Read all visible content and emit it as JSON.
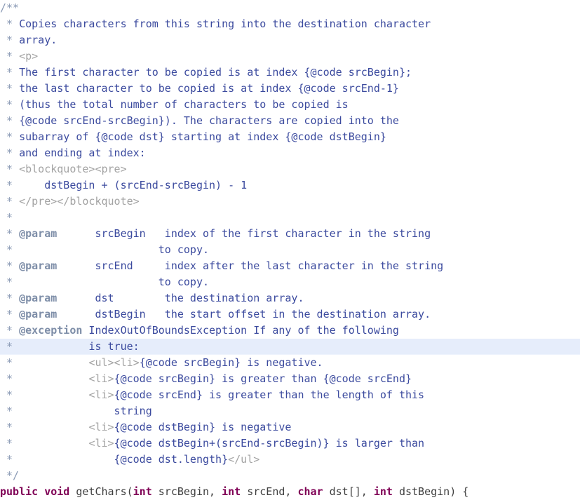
{
  "editor": {
    "language": "Java",
    "font_size_px": 15,
    "line_height_px": 23,
    "colors": {
      "background": "#ffffff",
      "comment": "#3b4a9e",
      "comment_punctuation": "#8a9ab5",
      "html_tag": "#a3a3a3",
      "javadoc_tag": "#7e8ea8",
      "keyword": "#7f0055",
      "identifier": "#3f3f3f",
      "current_line_highlight": "#e6edfb"
    },
    "current_line_index": 21,
    "lines": [
      {
        "id": "l1",
        "text": "/**",
        "tokens": [
          {
            "t": "/**",
            "c": "tok-comment-punct"
          }
        ]
      },
      {
        "id": "l2",
        "text": " * Copies characters from this string into the destination character",
        "tokens": [
          {
            "t": " * ",
            "c": "tok-comment-punct"
          },
          {
            "t": "Copies characters from this string into the destination character",
            "c": "tok-comment"
          }
        ]
      },
      {
        "id": "l3",
        "text": " * array.",
        "tokens": [
          {
            "t": " * ",
            "c": "tok-comment-punct"
          },
          {
            "t": "array.",
            "c": "tok-comment"
          }
        ]
      },
      {
        "id": "l4",
        "text": " * <p>",
        "tokens": [
          {
            "t": " * ",
            "c": "tok-comment-punct"
          },
          {
            "t": "<p>",
            "c": "tok-html"
          }
        ]
      },
      {
        "id": "l5",
        "text": " * The first character to be copied is at index {@code srcBegin};",
        "tokens": [
          {
            "t": " * ",
            "c": "tok-comment-punct"
          },
          {
            "t": "The first character to be copied is at index {@code srcBegin};",
            "c": "tok-comment"
          }
        ]
      },
      {
        "id": "l6",
        "text": " * the last character to be copied is at index {@code srcEnd-1}",
        "tokens": [
          {
            "t": " * ",
            "c": "tok-comment-punct"
          },
          {
            "t": "the last character to be copied is at index {@code srcEnd-1}",
            "c": "tok-comment"
          }
        ]
      },
      {
        "id": "l7",
        "text": " * (thus the total number of characters to be copied is",
        "tokens": [
          {
            "t": " * ",
            "c": "tok-comment-punct"
          },
          {
            "t": "(thus the total number of characters to be copied is",
            "c": "tok-comment"
          }
        ]
      },
      {
        "id": "l8",
        "text": " * {@code srcEnd-srcBegin}). The characters are copied into the",
        "tokens": [
          {
            "t": " * ",
            "c": "tok-comment-punct"
          },
          {
            "t": "{@code srcEnd-srcBegin}). The characters are copied into the",
            "c": "tok-comment"
          }
        ]
      },
      {
        "id": "l9",
        "text": " * subarray of {@code dst} starting at index {@code dstBegin}",
        "tokens": [
          {
            "t": " * ",
            "c": "tok-comment-punct"
          },
          {
            "t": "subarray of {@code dst} starting at index {@code dstBegin}",
            "c": "tok-comment"
          }
        ]
      },
      {
        "id": "l10",
        "text": " * and ending at index:",
        "tokens": [
          {
            "t": " * ",
            "c": "tok-comment-punct"
          },
          {
            "t": "and ending at index:",
            "c": "tok-comment"
          }
        ]
      },
      {
        "id": "l11",
        "text": " * <blockquote><pre>",
        "tokens": [
          {
            "t": " * ",
            "c": "tok-comment-punct"
          },
          {
            "t": "<blockquote><pre>",
            "c": "tok-html"
          }
        ]
      },
      {
        "id": "l12",
        "text": " *     dstBegin + (srcEnd-srcBegin) - 1",
        "tokens": [
          {
            "t": " * ",
            "c": "tok-comment-punct"
          },
          {
            "t": "    dstBegin + (srcEnd-srcBegin) - 1",
            "c": "tok-comment"
          }
        ]
      },
      {
        "id": "l13",
        "text": " * </pre></blockquote>",
        "tokens": [
          {
            "t": " * ",
            "c": "tok-comment-punct"
          },
          {
            "t": "</pre></blockquote>",
            "c": "tok-html"
          }
        ]
      },
      {
        "id": "l14",
        "text": " *",
        "tokens": [
          {
            "t": " *",
            "c": "tok-comment-punct"
          }
        ]
      },
      {
        "id": "l15",
        "text": " * @param      srcBegin   index of the first character in the string",
        "tokens": [
          {
            "t": " * ",
            "c": "tok-comment-punct"
          },
          {
            "t": "@param",
            "c": "tok-tag"
          },
          {
            "t": "      srcBegin   index of the first character in the string",
            "c": "tok-comment"
          }
        ]
      },
      {
        "id": "l16",
        "text": " *                        to copy.",
        "tokens": [
          {
            "t": " * ",
            "c": "tok-comment-punct"
          },
          {
            "t": "                      to copy.",
            "c": "tok-comment"
          }
        ]
      },
      {
        "id": "l17",
        "text": " * @param      srcEnd     index after the last character in the string",
        "tokens": [
          {
            "t": " * ",
            "c": "tok-comment-punct"
          },
          {
            "t": "@param",
            "c": "tok-tag"
          },
          {
            "t": "      srcEnd     index after the last character in the string",
            "c": "tok-comment"
          }
        ]
      },
      {
        "id": "l18",
        "text": " *                        to copy.",
        "tokens": [
          {
            "t": " * ",
            "c": "tok-comment-punct"
          },
          {
            "t": "                      to copy.",
            "c": "tok-comment"
          }
        ]
      },
      {
        "id": "l19",
        "text": " * @param      dst        the destination array.",
        "tokens": [
          {
            "t": " * ",
            "c": "tok-comment-punct"
          },
          {
            "t": "@param",
            "c": "tok-tag"
          },
          {
            "t": "      dst        the destination array.",
            "c": "tok-comment"
          }
        ]
      },
      {
        "id": "l20",
        "text": " * @param      dstBegin   the start offset in the destination array.",
        "tokens": [
          {
            "t": " * ",
            "c": "tok-comment-punct"
          },
          {
            "t": "@param",
            "c": "tok-tag"
          },
          {
            "t": "      dstBegin   the start offset in the destination array.",
            "c": "tok-comment"
          }
        ]
      },
      {
        "id": "l21",
        "text": " * @exception IndexOutOfBoundsException If any of the following",
        "tokens": [
          {
            "t": " * ",
            "c": "tok-comment-punct"
          },
          {
            "t": "@exception",
            "c": "tok-tag"
          },
          {
            "t": " IndexOutOfBoundsException If any of the following",
            "c": "tok-comment"
          }
        ]
      },
      {
        "id": "l22",
        "text": " *            is true:",
        "tokens": [
          {
            "t": " * ",
            "c": "tok-comment-punct"
          },
          {
            "t": "           is true:",
            "c": "tok-comment"
          }
        ]
      },
      {
        "id": "l23",
        "text": " *            <ul><li>{@code srcBegin} is negative.",
        "tokens": [
          {
            "t": " * ",
            "c": "tok-comment-punct"
          },
          {
            "t": "           ",
            "c": "tok-comment"
          },
          {
            "t": "<ul><li>",
            "c": "tok-html"
          },
          {
            "t": "{@code srcBegin} is negative.",
            "c": "tok-comment"
          }
        ]
      },
      {
        "id": "l24",
        "text": " *            <li>{@code srcBegin} is greater than {@code srcEnd}",
        "tokens": [
          {
            "t": " * ",
            "c": "tok-comment-punct"
          },
          {
            "t": "           ",
            "c": "tok-comment"
          },
          {
            "t": "<li>",
            "c": "tok-html"
          },
          {
            "t": "{@code srcBegin} is greater than {@code srcEnd}",
            "c": "tok-comment"
          }
        ]
      },
      {
        "id": "l25",
        "text": " *            <li>{@code srcEnd} is greater than the length of this",
        "tokens": [
          {
            "t": " * ",
            "c": "tok-comment-punct"
          },
          {
            "t": "           ",
            "c": "tok-comment"
          },
          {
            "t": "<li>",
            "c": "tok-html"
          },
          {
            "t": "{@code srcEnd} is greater than the length of this",
            "c": "tok-comment"
          }
        ]
      },
      {
        "id": "l26",
        "text": " *                string",
        "tokens": [
          {
            "t": " * ",
            "c": "tok-comment-punct"
          },
          {
            "t": "               string",
            "c": "tok-comment"
          }
        ]
      },
      {
        "id": "l27",
        "text": " *            <li>{@code dstBegin} is negative",
        "tokens": [
          {
            "t": " * ",
            "c": "tok-comment-punct"
          },
          {
            "t": "           ",
            "c": "tok-comment"
          },
          {
            "t": "<li>",
            "c": "tok-html"
          },
          {
            "t": "{@code dstBegin} is negative",
            "c": "tok-comment"
          }
        ]
      },
      {
        "id": "l28",
        "text": " *            <li>{@code dstBegin+(srcEnd-srcBegin)} is larger than",
        "tokens": [
          {
            "t": " * ",
            "c": "tok-comment-punct"
          },
          {
            "t": "           ",
            "c": "tok-comment"
          },
          {
            "t": "<li>",
            "c": "tok-html"
          },
          {
            "t": "{@code dstBegin+(srcEnd-srcBegin)} is larger than",
            "c": "tok-comment"
          }
        ]
      },
      {
        "id": "l29",
        "text": " *                {@code dst.length}</ul>",
        "tokens": [
          {
            "t": " * ",
            "c": "tok-comment-punct"
          },
          {
            "t": "               {@code dst.length}",
            "c": "tok-comment"
          },
          {
            "t": "</ul>",
            "c": "tok-html"
          }
        ]
      },
      {
        "id": "l30",
        "text": " */",
        "tokens": [
          {
            "t": " */",
            "c": "tok-comment-punct"
          }
        ]
      },
      {
        "id": "l31",
        "text": "public void getChars(int srcBegin, int srcEnd, char dst[], int dstBegin) {",
        "tokens": [
          {
            "t": "public",
            "c": "tok-keyword"
          },
          {
            "t": " ",
            "c": "tok-default"
          },
          {
            "t": "void",
            "c": "tok-keyword"
          },
          {
            "t": " getChars(",
            "c": "tok-default"
          },
          {
            "t": "int",
            "c": "tok-keyword"
          },
          {
            "t": " srcBegin, ",
            "c": "tok-default"
          },
          {
            "t": "int",
            "c": "tok-keyword"
          },
          {
            "t": " srcEnd, ",
            "c": "tok-default"
          },
          {
            "t": "char",
            "c": "tok-keyword"
          },
          {
            "t": " dst[], ",
            "c": "tok-default"
          },
          {
            "t": "int",
            "c": "tok-keyword"
          },
          {
            "t": " dstBegin) {",
            "c": "tok-default"
          }
        ]
      }
    ]
  }
}
